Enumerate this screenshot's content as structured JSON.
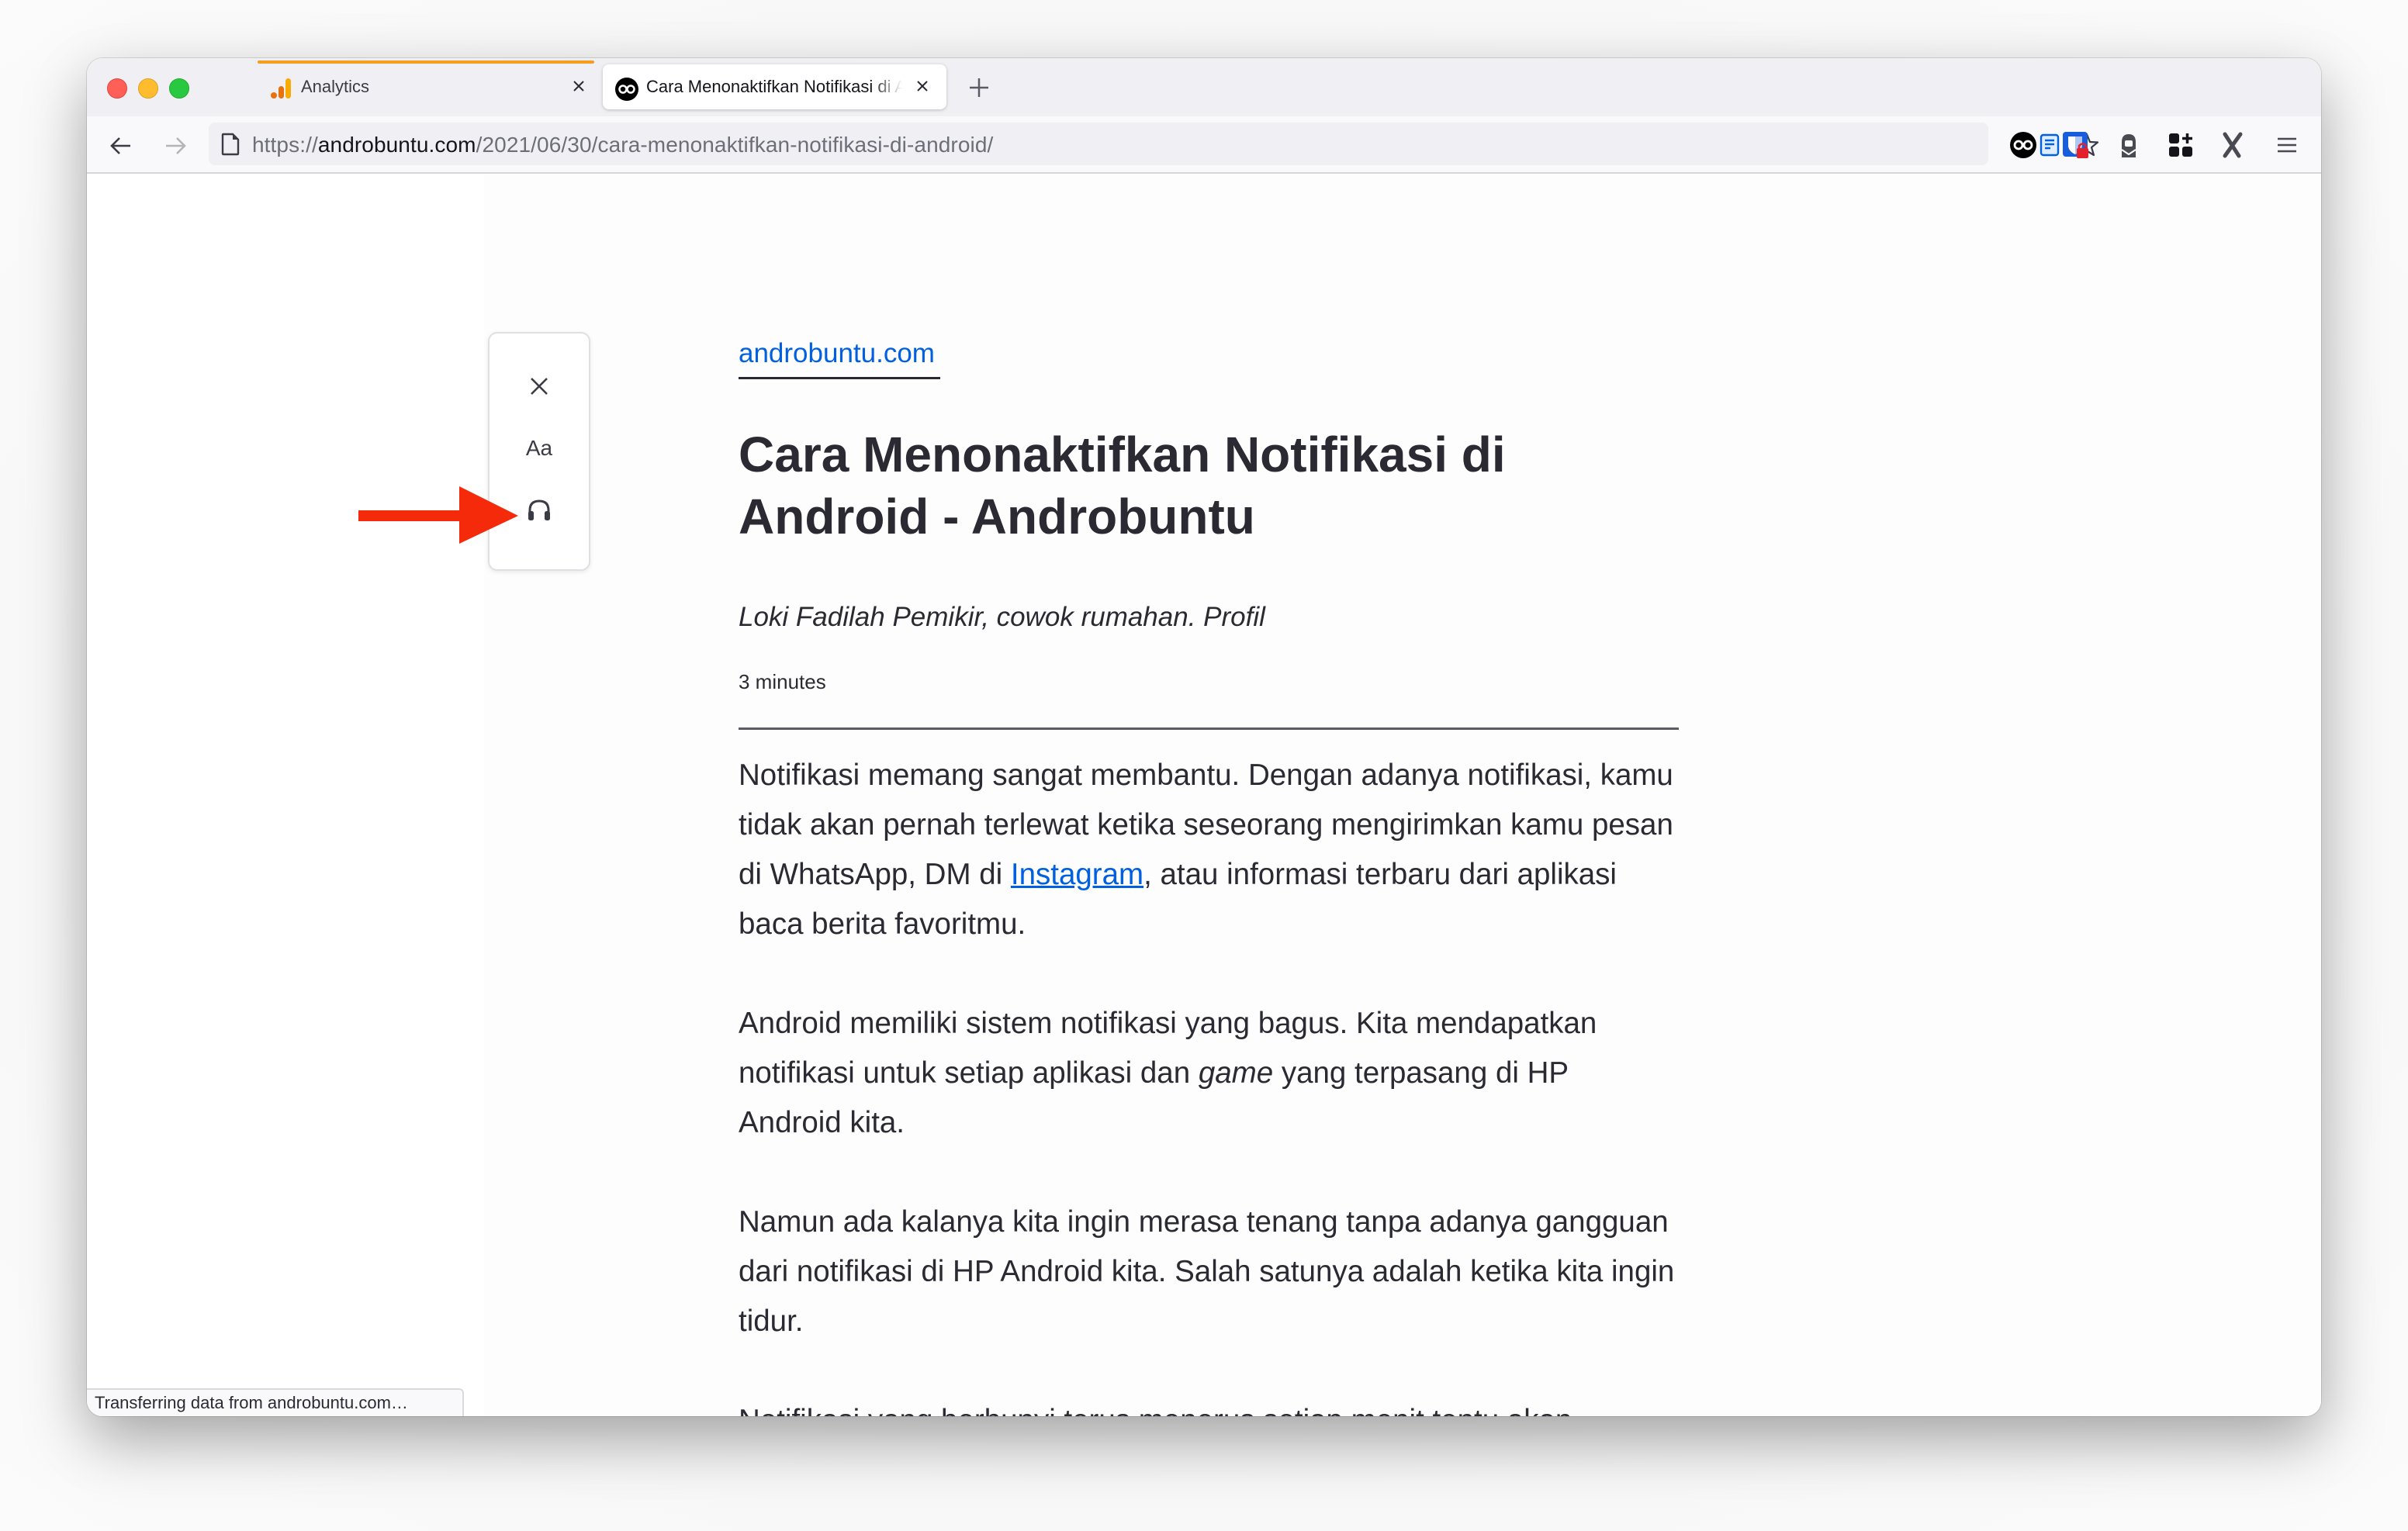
{
  "browser": {
    "tabs": [
      {
        "title": "Analytics",
        "favicon": "analytics-bars-icon",
        "active": false,
        "loading": true,
        "close_label": "×"
      },
      {
        "title": "Cara Menonaktifkan Notifikasi di Android - Androbuntu",
        "favicon": "androbuntu-owl-icon",
        "active": true,
        "close_label": "×"
      }
    ],
    "new_tab_label": "+",
    "url": {
      "scheme": "https://",
      "host": "androbuntu.com",
      "path": "/2021/06/30/cara-menonaktifkan-notifikasi-di-android/"
    },
    "toolbar_icons": [
      "back-arrow-icon",
      "forward-arrow-icon",
      "page-icon",
      "reader-view-icon",
      "bookmark-star-icon",
      "androbuntu-extension-icon",
      "bitwarden-icon",
      "proton-icon",
      "add-extension-grid-icon",
      "x-extension-icon",
      "hamburger-menu-icon"
    ],
    "colors": {
      "accent_link": "#0060df",
      "loading_bar": "#f59e1f",
      "annotation_arrow": "#f42a0a"
    }
  },
  "reader_toolbar": {
    "close_icon": "close-icon",
    "type_controls_label": "Aa",
    "listen_icon": "headphones-icon"
  },
  "article": {
    "site_name": "androbuntu.com",
    "title": "Cara Menonaktifkan Notifikasi di Android - Androbuntu",
    "byline": "Loki Fadilah Pemikir, cowok rumahan. Profil",
    "reading_time": "3 minutes",
    "paragraphs": [
      {
        "before": "Notifikasi memang sangat membantu. Dengan adanya notifikasi, kamu tidak akan pernah terlewat ketika seseorang mengirimkan kamu pesan di WhatsApp, DM di ",
        "link": "Instagram",
        "after": ", atau informasi terbaru dari aplikasi baca berita favoritmu."
      },
      {
        "before": "Android memiliki sistem notifikasi yang bagus. Kita mendapatkan notifikasi untuk setiap aplikasi dan ",
        "em": "game",
        "after": " yang terpasang di HP Android kita."
      },
      {
        "text": "Namun ada kalanya kita ingin merasa tenang tanpa adanya gangguan dari notifikasi di HP Android kita. Salah satunya adalah ketika kita ingin tidur."
      },
      {
        "text": "Notifikasi yang berbunyi terus menerus setiap menit tentu akan mengganggu kita. Namun untungnya setiap aplikasi di Android"
      }
    ]
  },
  "status_bar": {
    "text": "Transferring data from androbuntu.com…"
  }
}
